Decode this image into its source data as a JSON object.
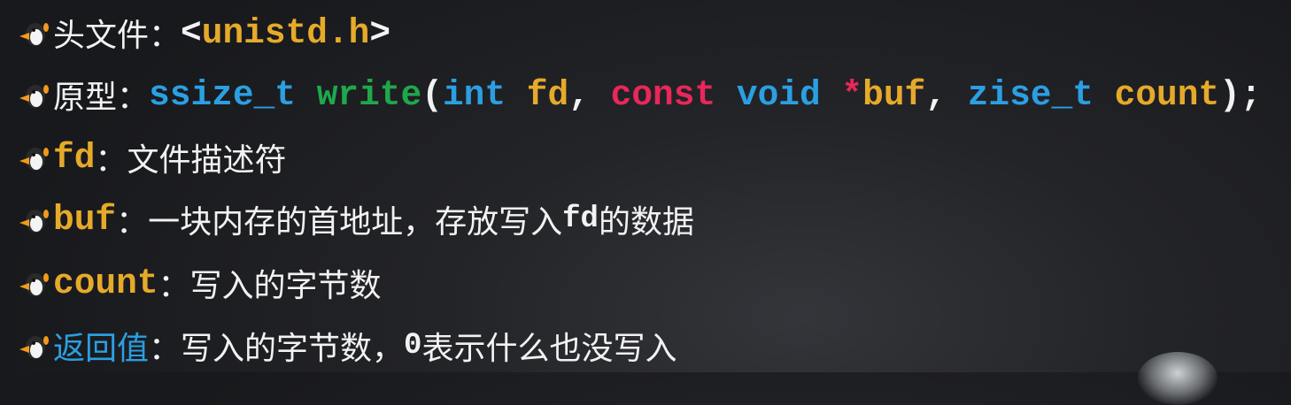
{
  "colors": {
    "type": "#2b9fe2",
    "function": "#1fa84b",
    "keyword": "#e8275a",
    "identifier": "#e6aa2a",
    "text": "#f2f2f2"
  },
  "bullet_icon": "penguin-icon",
  "lines": [
    {
      "label": "头文件",
      "sep": "：",
      "header": "<unistd.h>",
      "header_open": "<",
      "header_name": "unistd.h",
      "header_close": ">"
    },
    {
      "label": "原型",
      "sep": "：",
      "tokens": [
        "ssize_t",
        " ",
        "write",
        "(",
        "int",
        " ",
        "fd",
        ", ",
        "const",
        " ",
        "void",
        " ",
        "*",
        "buf",
        ", ",
        "zise_t",
        " ",
        "count",
        ");"
      ]
    },
    {
      "label": "fd",
      "sep": "：",
      "text": "文件描述符"
    },
    {
      "label": "buf",
      "sep": "：",
      "text": "一块内存的首地址，存放写入",
      "code": "fd",
      "text2": "的数据"
    },
    {
      "label": "count",
      "sep": "：",
      "text": "写入的字节数"
    },
    {
      "label": "返回值",
      "sep": "：",
      "text": "写入的字节数，",
      "code": "0",
      "text2": "表示什么也没写入"
    }
  ]
}
